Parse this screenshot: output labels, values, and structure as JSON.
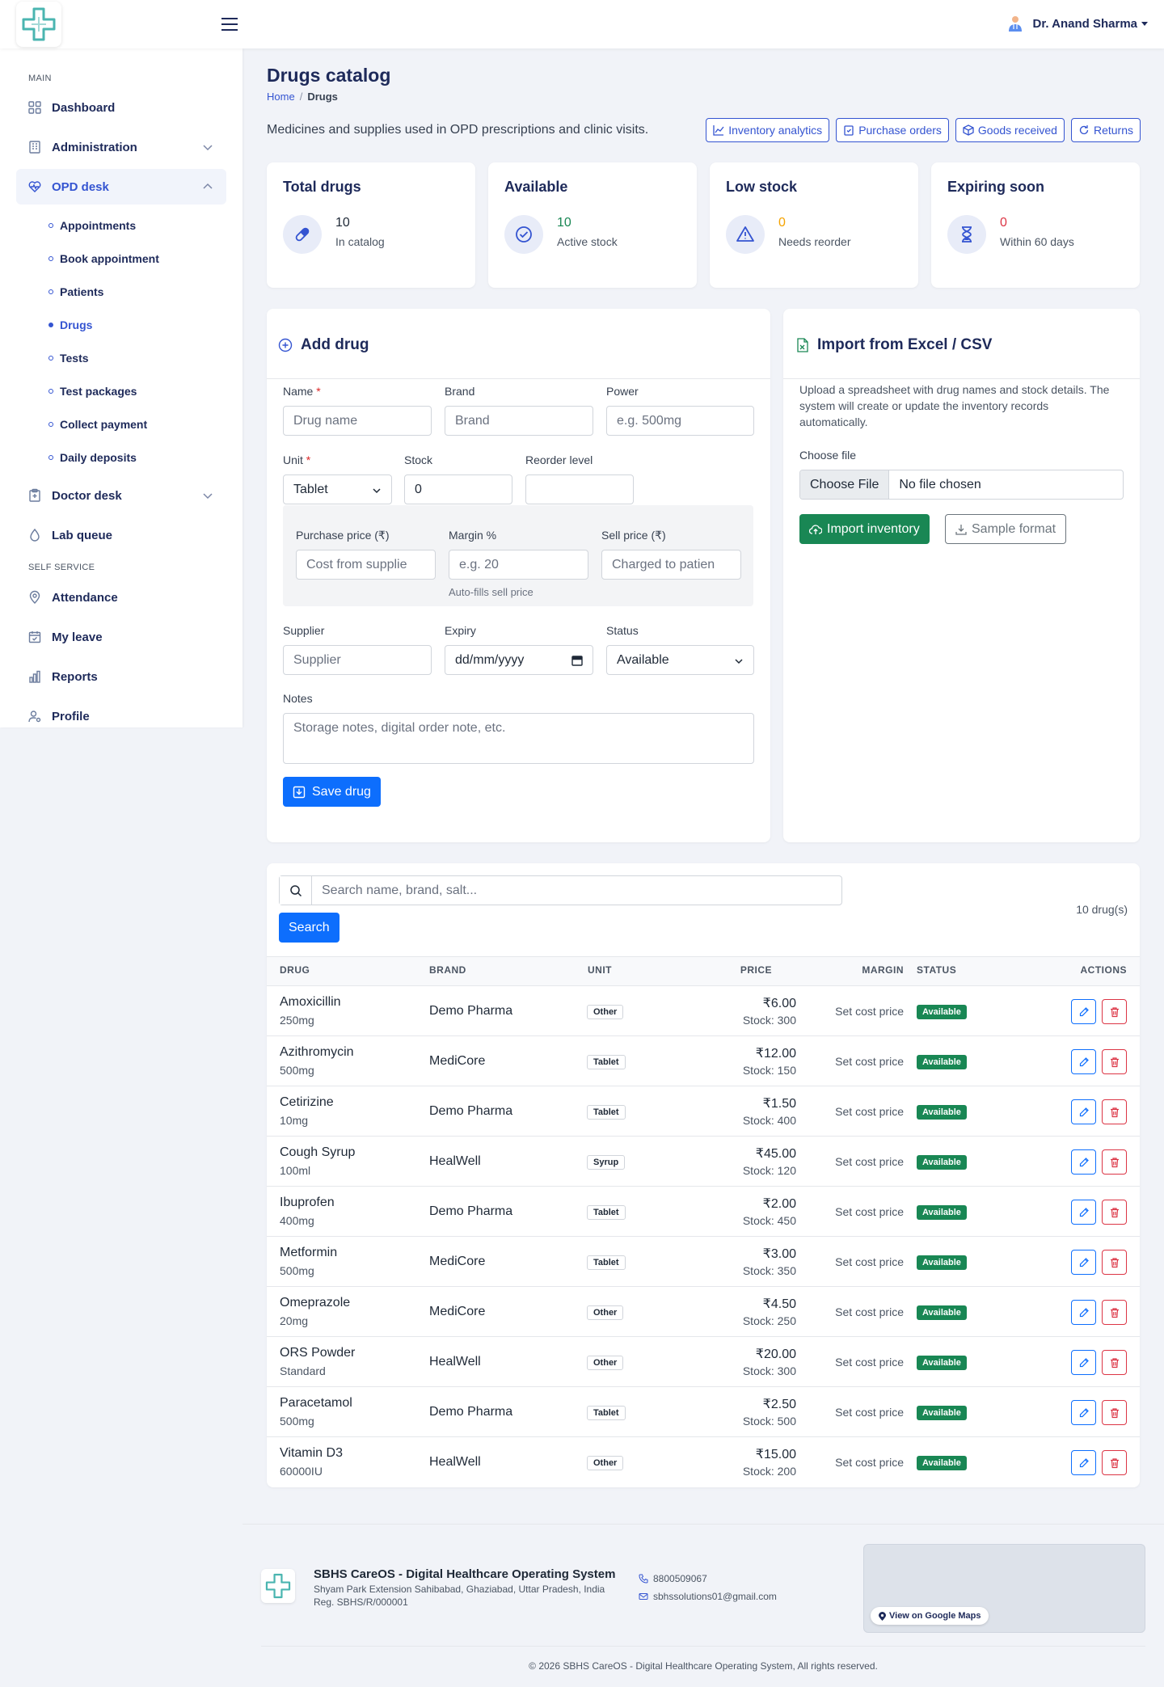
{
  "user": {
    "name": "Dr. Anand Sharma"
  },
  "sidebar": {
    "section_main": "MAIN",
    "section_self": "SELF SERVICE",
    "items": [
      {
        "label": "Dashboard"
      },
      {
        "label": "Administration"
      },
      {
        "label": "OPD desk"
      },
      {
        "label": "Doctor desk"
      },
      {
        "label": "Lab queue"
      },
      {
        "label": "Attendance"
      },
      {
        "label": "My leave"
      },
      {
        "label": "Reports"
      },
      {
        "label": "Profile"
      }
    ],
    "sub_items": [
      {
        "label": "Appointments"
      },
      {
        "label": "Book appointment"
      },
      {
        "label": "Patients"
      },
      {
        "label": "Drugs"
      },
      {
        "label": "Tests"
      },
      {
        "label": "Test packages"
      },
      {
        "label": "Collect payment"
      },
      {
        "label": "Daily deposits"
      }
    ]
  },
  "page": {
    "title": "Drugs catalog",
    "breadcrumb_home": "Home",
    "breadcrumb_current": "Drugs",
    "subtitle": "Medicines and supplies used in OPD prescriptions and clinic visits.",
    "header_buttons": [
      "Inventory analytics",
      "Purchase orders",
      "Goods received",
      "Returns"
    ]
  },
  "stats": [
    {
      "title": "Total drugs",
      "value": "10",
      "sub": "In catalog",
      "color": "#1f2937"
    },
    {
      "title": "Available",
      "value": "10",
      "sub": "Active stock",
      "color": "#198754"
    },
    {
      "title": "Low stock",
      "value": "0",
      "sub": "Needs reorder",
      "color": "#f5a300"
    },
    {
      "title": "Expiring soon",
      "value": "0",
      "sub": "Within 60 days",
      "color": "#dc3545"
    }
  ],
  "add_form": {
    "title": "Add drug",
    "name_label": "Name",
    "name_placeholder": "Drug name",
    "brand_label": "Brand",
    "brand_placeholder": "Brand",
    "power_label": "Power",
    "power_placeholder": "e.g. 500mg",
    "unit_label": "Unit",
    "unit_value": "Tablet",
    "stock_label": "Stock",
    "stock_value": "0",
    "reorder_label": "Reorder level",
    "purchase_label": "Purchase price (₹)",
    "purchase_placeholder": "Cost from supplie",
    "margin_label": "Margin %",
    "margin_placeholder": "e.g. 20",
    "margin_hint": "Auto-fills sell price",
    "sell_label": "Sell price (₹)",
    "sell_placeholder": "Charged to patien",
    "supplier_label": "Supplier",
    "supplier_placeholder": "Supplier",
    "expiry_label": "Expiry",
    "expiry_placeholder": "dd/mm/yyyy",
    "status_label": "Status",
    "status_value": "Available",
    "notes_label": "Notes",
    "notes_placeholder": "Storage notes, digital order note, etc.",
    "save_label": "Save drug"
  },
  "import": {
    "title": "Import from Excel / CSV",
    "description": "Upload a spreadsheet with drug names and stock details. The system will create or update the inventory records automatically.",
    "file_label": "Choose file",
    "choose_button": "Choose File",
    "no_file": "No file chosen",
    "import_button": "Import inventory",
    "sample_button": "Sample format"
  },
  "search": {
    "placeholder": "Search name, brand, salt...",
    "button": "Search",
    "count": "10 drug(s)"
  },
  "table": {
    "headers": [
      "DRUG",
      "BRAND",
      "UNIT",
      "PRICE",
      "MARGIN",
      "STATUS",
      "ACTIONS"
    ],
    "rows": [
      {
        "name": "Amoxicillin",
        "power": "250mg",
        "brand": "Demo Pharma",
        "unit": "Other",
        "price": "₹6.00",
        "stock": "Stock: 300",
        "margin": "Set cost price",
        "status": "Available"
      },
      {
        "name": "Azithromycin",
        "power": "500mg",
        "brand": "MediCore",
        "unit": "Tablet",
        "price": "₹12.00",
        "stock": "Stock: 150",
        "margin": "Set cost price",
        "status": "Available"
      },
      {
        "name": "Cetirizine",
        "power": "10mg",
        "brand": "Demo Pharma",
        "unit": "Tablet",
        "price": "₹1.50",
        "stock": "Stock: 400",
        "margin": "Set cost price",
        "status": "Available"
      },
      {
        "name": "Cough Syrup",
        "power": "100ml",
        "brand": "HealWell",
        "unit": "Syrup",
        "price": "₹45.00",
        "stock": "Stock: 120",
        "margin": "Set cost price",
        "status": "Available"
      },
      {
        "name": "Ibuprofen",
        "power": "400mg",
        "brand": "Demo Pharma",
        "unit": "Tablet",
        "price": "₹2.00",
        "stock": "Stock: 450",
        "margin": "Set cost price",
        "status": "Available"
      },
      {
        "name": "Metformin",
        "power": "500mg",
        "brand": "MediCore",
        "unit": "Tablet",
        "price": "₹3.00",
        "stock": "Stock: 350",
        "margin": "Set cost price",
        "status": "Available"
      },
      {
        "name": "Omeprazole",
        "power": "20mg",
        "brand": "MediCore",
        "unit": "Other",
        "price": "₹4.50",
        "stock": "Stock: 250",
        "margin": "Set cost price",
        "status": "Available"
      },
      {
        "name": "ORS Powder",
        "power": "Standard",
        "brand": "HealWell",
        "unit": "Other",
        "price": "₹20.00",
        "stock": "Stock: 300",
        "margin": "Set cost price",
        "status": "Available"
      },
      {
        "name": "Paracetamol",
        "power": "500mg",
        "brand": "Demo Pharma",
        "unit": "Tablet",
        "price": "₹2.50",
        "stock": "Stock: 500",
        "margin": "Set cost price",
        "status": "Available"
      },
      {
        "name": "Vitamin D3",
        "power": "60000IU",
        "brand": "HealWell",
        "unit": "Other",
        "price": "₹15.00",
        "stock": "Stock: 200",
        "margin": "Set cost price",
        "status": "Available"
      }
    ]
  },
  "footer": {
    "org": "SBHS CareOS - Digital Healthcare Operating System",
    "address": "Shyam Park Extension Sahibabad, Ghaziabad, Uttar Pradesh, India",
    "reg": "Reg. SBHS/R/000001",
    "phone": "8800509067",
    "email": "sbhssolutions01@gmail.com",
    "map_button": "View on Google Maps",
    "copyright": "© 2026 SBHS CareOS - Digital Healthcare Operating System, All rights reserved."
  },
  "colors": {
    "primary": "#3454d1",
    "accent": "#0d6efd",
    "success": "#198754",
    "danger": "#dc3545",
    "brand_teal": "#4ab5b0"
  }
}
